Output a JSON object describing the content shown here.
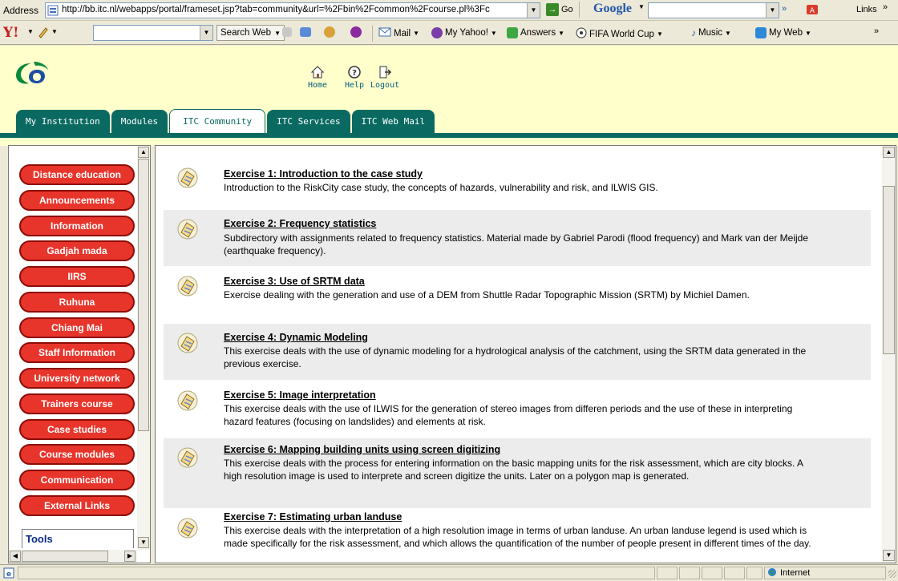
{
  "browser": {
    "address_label": "Address",
    "url": "http://bb.itc.nl/webapps/portal/frameset.jsp?tab=community&url=%2Fbin%2Fcommon%2Fcourse.pl%3Fc",
    "go_label": "Go",
    "google_label": "Google",
    "links_label": "Links",
    "toolbar_search_label": "Search Web",
    "toolbar_items": [
      "Mail",
      "My Yahoo!",
      "Answers",
      "FIFA World Cup",
      "Music",
      "My Web"
    ],
    "status_zone": "Internet"
  },
  "portal": {
    "top_links": [
      "Home",
      "Help",
      "Logout"
    ],
    "tabs": [
      "My Institution",
      "Modules",
      "ITC Community",
      "ITC Services",
      "ITC Web Mail"
    ],
    "active_tab": "ITC Community"
  },
  "sidebar": {
    "items": [
      "Distance education",
      "Announcements",
      "Information",
      "Gadjah mada",
      "IIRS",
      "Ruhuna",
      "Chiang Mai",
      "Staff Information",
      "University network",
      "Trainers course",
      "Case studies",
      "Course modules",
      "Communication",
      "External Links"
    ],
    "tools_label": "Tools"
  },
  "exercises": [
    {
      "title": "Exercise 1: Introduction to the case study",
      "description": "Introduction to the RiskCity case study, the concepts of hazards, vulnerability and risk, and ILWIS GIS."
    },
    {
      "title": "Exercise 2: Frequency statistics",
      "description": "Subdirectory with assignments related to frequency statistics. Material made by Gabriel Parodi (flood frequency) and Mark van der Meijde (earthquake frequency)."
    },
    {
      "title": "Exercise 3: Use of SRTM data",
      "description": "Exercise dealing with the generation and use of a DEM from Shuttle Radar Topographic Mission (SRTM) by Michiel Damen."
    },
    {
      "title": "Exercise 4: Dynamic Modeling",
      "description": "This exercise deals with the use of dynamic modeling for a hydrological analysis of the catchment, using the SRTM data generated in the previous exercise."
    },
    {
      "title": "Exercise 5: Image interpretation",
      "description": "This exercise deals with the use of ILWIS for the generation of stereo images from differen periods and the use of these in interpreting hazard features (focusing on landslides) and elements at risk."
    },
    {
      "title": "Exercise 6: Mapping building units using screen digitizing",
      "description": "This exercise deals with the process for entering information on the basic mapping units for the risk assessment, which are city blocks. A high resolution image is used to interprete and screen digitize the units. Later on a polygon map is generated."
    },
    {
      "title": "Exercise 7: Estimating urban landuse",
      "description": "This exercise deals with the interpretation of a high resolution image in terms of urban landuse. An urban landuse legend is used which is made specifically for the risk assessment, and which allows the quantification of the number of people present in different times of the day."
    }
  ]
}
